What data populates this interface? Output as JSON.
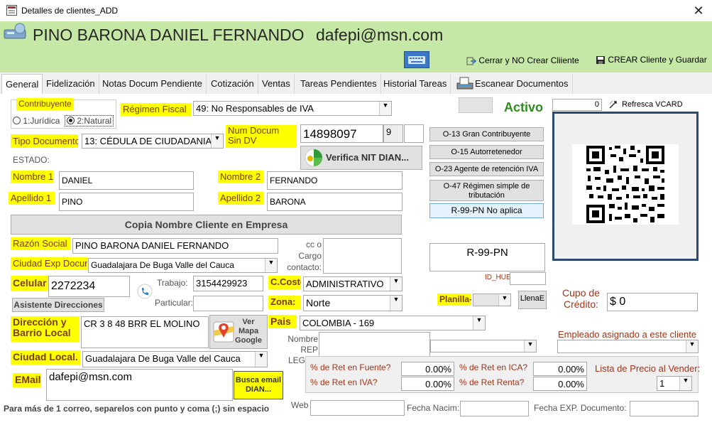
{
  "window": {
    "title": "Detalles de clientes_ADD",
    "close_glyph": "✕"
  },
  "header": {
    "client_name": "PINO BARONA DANIEL FERNANDO",
    "email": "dafepi@msn.com",
    "close_no_create_label": "Cerrar y NO Crear Cliiente",
    "create_save_label": "CREAR Cliente y Guardar"
  },
  "tabs": [
    "General",
    "Fidelización",
    "Notas Docum Pendiente",
    "Cotización",
    "Ventas",
    "Tareas Pendientes",
    "Historial Tareas",
    "Escanear Documentos"
  ],
  "form": {
    "contribuyente_label": "Contribuyente",
    "radio_juridica": "1:Jurídica",
    "radio_natural": "2:Natural",
    "regimen_label": "Régimen Fiscal",
    "regimen_value": "49: No Responsables de IVA",
    "tipo_doc_label": "Tipo Documento",
    "tipo_doc_value": "13: CÉDULA DE CIUDADANIA",
    "num_doc_label": "Num Docum Sin DV",
    "num_doc_value": "14898097",
    "dv_value": "9",
    "estado_label": "ESTADO:",
    "verifica_label": "Verifica NIT DIAN...",
    "nombre1_label": "Nombre 1",
    "nombre1_value": "DANIEL",
    "nombre2_label": "Nombre 2",
    "nombre2_value": "FERNANDO",
    "apellido1_label": "Apellido 1",
    "apellido1_value": "PINO",
    "apellido2_label": "Apellido 2",
    "apellido2_value": "BARONA",
    "copia_label": "Copia Nombre Cliente en Empresa",
    "razon_label": "Razón Social",
    "razon_value": "PINO BARONA DANIEL FERNANDO",
    "cc_cargo_label": "cc o Cargo contacto:",
    "ciudad_exp_label": "Ciudad Exp Docum",
    "ciudad_exp_value": "Guadalajara De Buga  Valle del Cauca",
    "celular_label": "Celular:",
    "celular_value": "2272234",
    "trabajo_label": "Trabajo:",
    "trabajo_value": "3154429923",
    "particular_label": "Particular:",
    "asistente_label": "Asistente Direcciones",
    "ccosto_label": "C.Costo",
    "ccosto_value": "ADMINISTRATIVO",
    "zona_label": "Zona:",
    "zona_value": "Norte",
    "direccion_label": "Dirección y Barrio Local",
    "direccion_value": "CR 3 8 48 BRR EL MOLINO",
    "ver_mapa_label": "Ver Mapa Google",
    "pais_label": "Pais",
    "pais_value": "COLOMBIA - 169",
    "ciudad_local_label": "Ciudad Local.",
    "ciudad_local_value": "Guadalajara De Buga  Valle del Cauca",
    "nombre_rep_label": "Nombre REP LEGAL:",
    "email_label": "EMail",
    "email_value": "dafepi@msn.com",
    "busca_email_label": "Busca email DIAN...",
    "note_text": "Para más de 1 correo, separelos con punto y coma (;) sin espacio",
    "web_label": "Web",
    "fecha_nacim_label": "Fecha Nacim:",
    "fecha_exp_label": "Fecha EXP. Documento:"
  },
  "right": {
    "activo_label": "Activo",
    "counter_value": "0",
    "refresca_label": "Refresca VCARD",
    "resp_buttons": [
      "O-13 Gran Contribuyente",
      "O-15 Autorretenedor",
      "O-23 Agente de retención IVA",
      "O-47 Régimen simple de tributación",
      "R-99-PN No aplica"
    ],
    "resp_box_value": "R-99-PN",
    "id_hue_label": "ID_HUE",
    "planilla_label": "Planilla-",
    "llenae_label": "LlenaE",
    "cupo_label": "Cupo de Crédito:",
    "cupo_value": "$ 0",
    "empleado_label": "Empleado asignado a este cliente",
    "ret_fuente_label": "% de Ret en Fuente?",
    "ret_fuente_value": "0.00%",
    "ret_ica_label": "% de Ret en ICA?",
    "ret_ica_value": "0.00%",
    "ret_iva_label": "% de Ret en IVA?",
    "ret_iva_value": "0.00%",
    "ret_renta_label": "% de Ret Renta?",
    "ret_renta_value": "0.00%",
    "lista_precio_label": "Lista de Precio al Vender:",
    "lista_precio_value": "1"
  },
  "colors": {
    "header_green": "#c6e8a6",
    "label_yellow": "#ffff00",
    "activo_green": "#2e8b1e",
    "qr_frame": "#2b4a6f"
  },
  "icons": [
    "app-icon",
    "close-icon",
    "user-avatar-icon",
    "keyboard-icon",
    "exit-icon",
    "save-icon",
    "scanner-icon",
    "refresh-icon",
    "phone-icon",
    "map-pin-icon",
    "dian-logo-icon",
    "qr-code"
  ]
}
